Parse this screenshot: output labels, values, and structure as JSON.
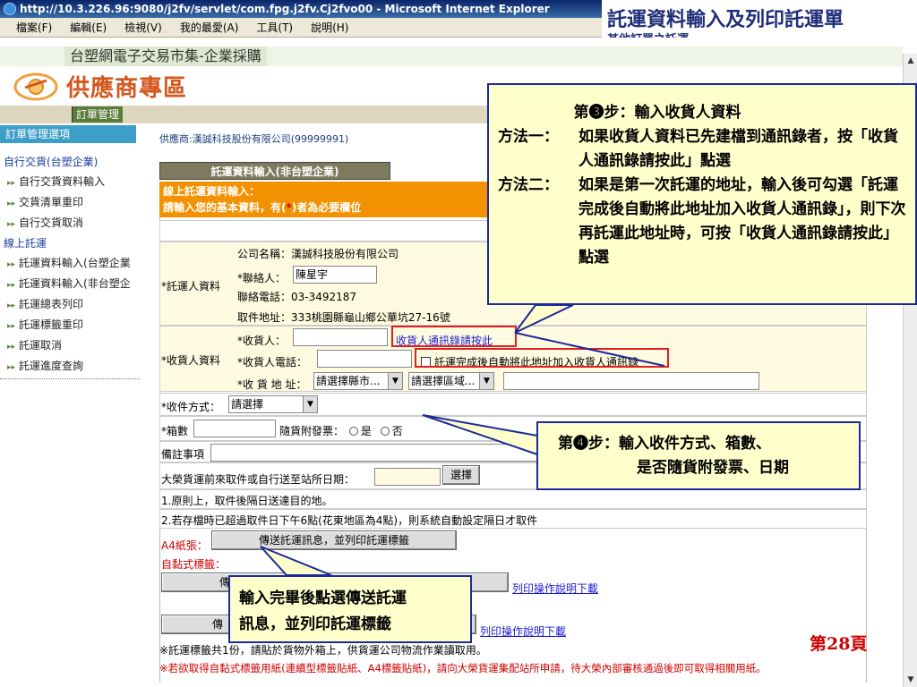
{
  "window": {
    "title": "http://10.3.226.96:9080/j2fv/servlet/com.fpg.j2fv.Cj2fvo00 - Microsoft Internet Explorer",
    "menu": [
      "檔案(F)",
      "編輯(E)",
      "檢視(V)",
      "我的最愛(A)",
      "工具(T)",
      "說明(H)"
    ]
  },
  "slide": {
    "title": "託運資料輸入及列印託運單",
    "subtitle": "其他訂單之託運",
    "page": "第28頁"
  },
  "site": {
    "brand": "台塑網電子交易市集-企業採購",
    "logo": "供應商專區",
    "nav_tab": "訂單管理"
  },
  "sidebar": {
    "header": "訂單管理選項",
    "group1": "自行交貨(台塑企業)",
    "items1": [
      "自行交貨資料輸入",
      "交貨清單重印",
      "自行交貨取消"
    ],
    "group2": "線上託運",
    "items2": [
      "託運資料輸入(台塑企業",
      "託運資料輸入(非台塑企",
      "託運總表列印",
      "託運標籤重印",
      "託運取消",
      "託運進度查詢"
    ]
  },
  "content": {
    "vendor": "供應商:漢誠科技股份有限公司(99999991)",
    "section_button": "託運資料輸入(非台塑企業)",
    "head_line1": "線上託運資料輸入：",
    "head_line2_a": "請輸入您的基本資料，有(",
    "head_line2_req": "*",
    "head_line2_b": ")者為必要欄位",
    "sender_label": "*託運人資料",
    "company_label": "公司名稱：漢誠科技股份有限公司",
    "contact_label": "*聯絡人：",
    "contact_value": "陳星宇",
    "phone_label": "聯絡電話：03-3492187",
    "pickup_label": "取件地址：333桃園縣龜山鄉公華坑27-16號",
    "receiver_label": "*收貨人資料",
    "recv_name_label": "*收貨人：",
    "recv_link": "收貨人通訊錄請按此",
    "recv_phone_label": "*收貨人電話：",
    "recv_checkbox": "託運完成後自動將此地址加入收貨人通訊錄",
    "recv_addr_label": "*收 貨 地 址：",
    "county_select": "請選擇縣市...",
    "district_select": "請選擇區域...",
    "method_label": "*收件方式：",
    "method_select": "請選擇",
    "boxes_label": "*箱數",
    "invoice_label": "隨貨附發票：",
    "invoice_yes": "是",
    "invoice_no": "否",
    "remark_label": "備註事項",
    "date_label": "大榮貨運前來取件或自行送至站所日期：",
    "date_button": "選擇",
    "note1": "1.原則上，取件後隔日送達目的地。",
    "note2": "2.若存檔時已超過取件日下午6點(花東地區為4點)，則系統自動設定隔日才取件",
    "a4_label": "A4紙張：",
    "a4_button": "傳送託運訊息，並列印託運標籤",
    "sticker_label": "自黏式標籤：",
    "btn_partial1": "傳",
    "btn_partial2": "傳",
    "print_link1": "列印操作說明下載",
    "print_link2": "列印操作說明下載",
    "footer1": "※託運標籤共1份，請貼於貨物外箱上，供貨運公司物流作業讀取用。",
    "footer2": "※若欲取得自黏式標籤用紙(連續型標籤貼紙、A4標籤貼紙)，請向大榮貨運集配站所申請，待大榮內部審核通過後即可取得相關用紙。"
  },
  "callouts": {
    "step3_title": "第❸步：輸入收貨人資料",
    "m1_key": "方法一：",
    "m1_text": "如果收貨人資料已先建檔到通訊錄者，按「收貨人通訊錄請按此」點選",
    "m2_key": "方法二：",
    "m2_text": "如果是第一次託運的地址，輸入後可勾選「託運完成後自動將此地址加入收貨人通訊錄」，則下次再託運此地址時，可按「收貨人通訊錄請按此」點選",
    "step4_line1": "第❹步：輸入收件方式、箱數、",
    "step4_line2": "是否隨貨附發票、日期",
    "step5_line1": "輸入完畢後點選傳送託運",
    "step5_line2": "訊息，並列印託運標籤"
  },
  "colors": {
    "callout_border": "#1a2a9a",
    "callout_fill": "#ffffcc",
    "highlight_red": "#e02020",
    "orange_header": "#f39200",
    "logo_orange": "#d4571d"
  }
}
